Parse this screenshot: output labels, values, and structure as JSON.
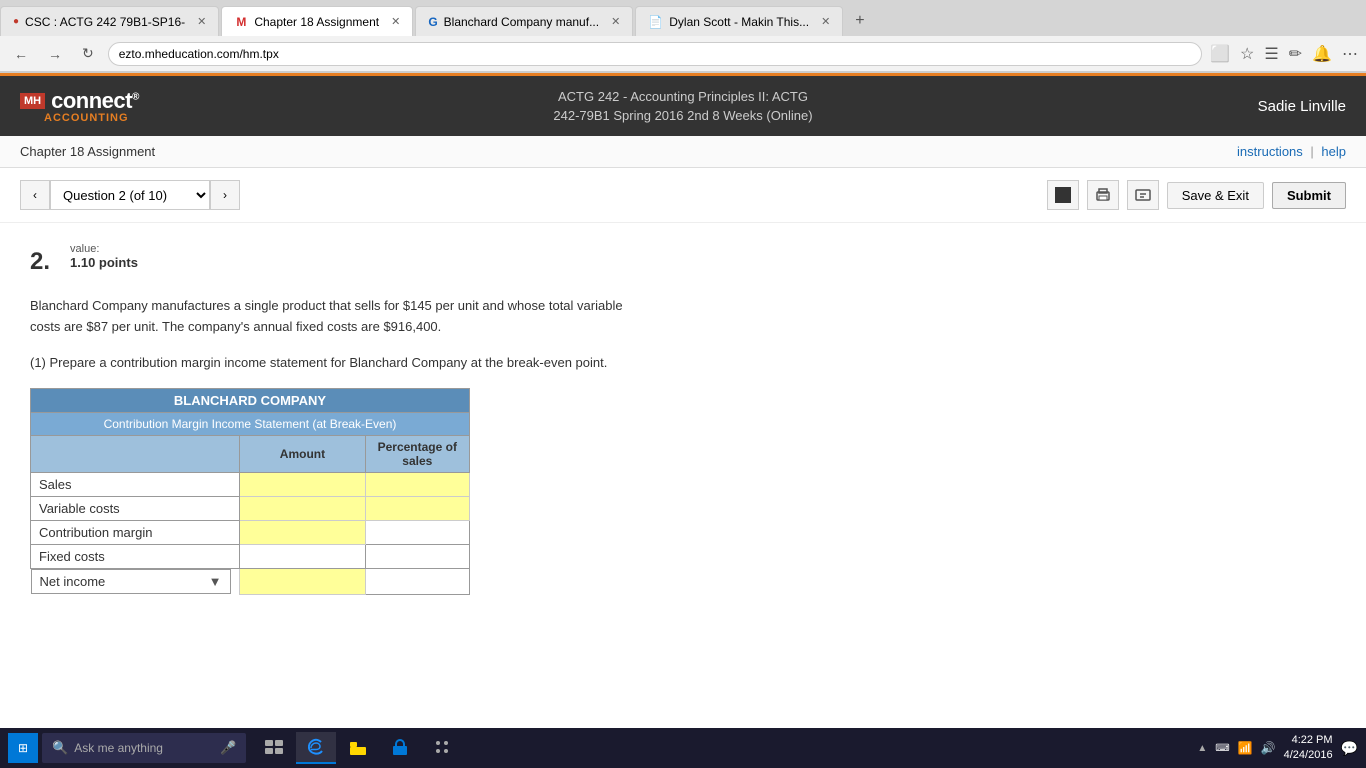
{
  "browser": {
    "tabs": [
      {
        "label": "CSC : ACTG 242 79B1-SP16-",
        "active": false,
        "favicon": "🔴"
      },
      {
        "label": "Chapter 18 Assignment",
        "active": true,
        "favicon": "M"
      },
      {
        "label": "Blanchard Company manuf...",
        "active": false,
        "favicon": "G"
      },
      {
        "label": "Dylan Scott - Makin This...",
        "active": false,
        "favicon": "📄"
      }
    ],
    "url": "ezto.mheducation.com/hm.tpx"
  },
  "header": {
    "logo_text": "connect",
    "accounting_label": "ACCOUNTING",
    "course_line1": "ACTG 242 - Accounting Principles II: ACTG",
    "course_line2": "242-79B1 Spring 2016 2nd 8 Weeks (Online)",
    "user_name": "Sadie Linville"
  },
  "page": {
    "title": "Chapter 18 Assignment",
    "instructions_label": "instructions",
    "help_label": "help"
  },
  "navigation": {
    "question_label": "Question 2 (of 10)",
    "save_exit_label": "Save & Exit",
    "submit_label": "Submit"
  },
  "question": {
    "number": "2.",
    "value_label": "value:",
    "points": "1.10 points",
    "text_line1": "Blanchard Company manufactures a single product that sells for $145 per unit and whose total variable",
    "text_line2": "costs are $87 per unit. The company's annual fixed costs are $916,400.",
    "instruction": "(1) Prepare a contribution margin income statement for Blanchard Company at the break-even point.",
    "table": {
      "title": "BLANCHARD COMPANY",
      "subtitle": "Contribution Margin Income Statement (at Break-Even)",
      "col_amount": "Amount",
      "col_pct": "Percentage of sales",
      "rows": [
        {
          "label": "Sales",
          "has_amount_input": true,
          "has_pct_input": true
        },
        {
          "label": "Variable costs",
          "has_amount_input": true,
          "has_pct_input": true
        },
        {
          "label": "Contribution margin",
          "has_amount_input": true,
          "has_pct_input": false
        },
        {
          "label": "Fixed costs",
          "has_amount_input": false,
          "has_pct_input": false
        },
        {
          "label": "Net income",
          "has_amount_input": true,
          "has_pct_input": false,
          "has_dropdown": true
        }
      ]
    }
  },
  "taskbar": {
    "start_label": "⊞",
    "search_placeholder": "Ask me anything",
    "time": "4:22 PM",
    "date": "4/24/2016"
  }
}
